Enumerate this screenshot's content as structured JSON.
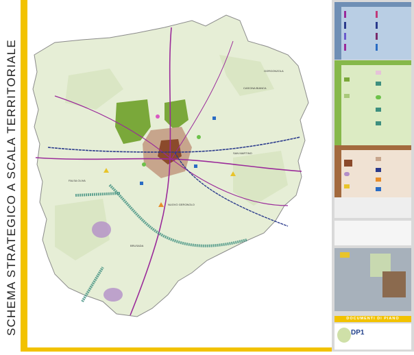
{
  "title": "SCHEMA STRATEGICO A SCALA TERRITORIALE",
  "footer": {
    "docs_bar": "DOCUMENTI DI PIANO",
    "code": "DP1"
  },
  "colors": {
    "accent_yellow": "#f2c200",
    "map_land": "#e6eed6",
    "urban_core": "#8b4a2b",
    "park_green": "#7aa83a",
    "rail": "#2a3a8c",
    "road_purple": "#9a2a9a",
    "legend_blue": "#b9cee4",
    "legend_green": "#86b84a",
    "legend_brown": "#a36a3e"
  },
  "map": {
    "labels": [
      "CASCINA BIANCA",
      "GORGONZOLA",
      "FALSA OLIVA",
      "SAN MARTINO",
      "BRUSADA",
      "NUOVO GERONOLO"
    ]
  }
}
